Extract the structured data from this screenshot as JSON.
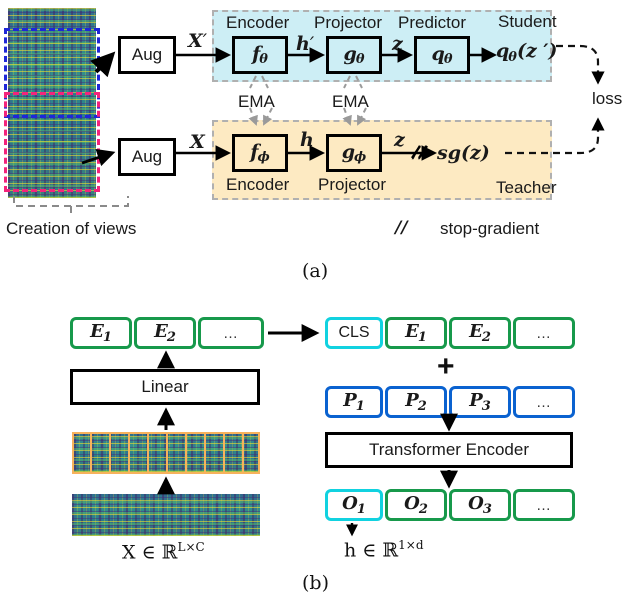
{
  "figure": {
    "panel_a_caption": "(a)",
    "panel_b_caption": "(b)"
  },
  "panel_a": {
    "creation_label": "Creation of views",
    "aug_top": "Aug",
    "aug_bottom": "Aug",
    "student_region_label": "Student",
    "teacher_region_label": "Teacher",
    "loss_label": "loss",
    "ema_label_1": "EMA",
    "ema_label_2": "EMA",
    "stopgrad_symbol": "//",
    "stopgrad_label": "stop-gradient",
    "student": {
      "encoder_label": "Encoder",
      "projector_label": "Projector",
      "predictor_label": "Predictor",
      "encoder_fn": "f",
      "encoder_sub": "θ",
      "projector_fn": "g",
      "projector_sub": "θ",
      "predictor_fn": "q",
      "predictor_sub": "θ",
      "input_signal": "X",
      "input_prime": "′",
      "h_signal": "h",
      "h_prime": "′",
      "z_signal": "z",
      "output_expr_fn": "q",
      "output_expr_sub": "θ",
      "output_expr_arg": "(z ′)"
    },
    "teacher": {
      "encoder_label": "Encoder",
      "projector_label": "Projector",
      "encoder_fn": "f",
      "encoder_sub": "ϕ",
      "projector_fn": "g",
      "projector_sub": "ϕ",
      "input_signal": "X",
      "h_signal": "h",
      "z_signal": "z",
      "sg_expr": "sg(z)"
    }
  },
  "panel_b": {
    "linear_label": "Linear",
    "transformer_label": "Transformer Encoder",
    "input_caption": "X ∈ ℝ",
    "input_caption_sup": "L×C",
    "output_caption": "h ∈ ℝ",
    "output_caption_sup": "1×d",
    "plus_symbol": "+",
    "embed_row": [
      {
        "base": "E",
        "sub": "1"
      },
      {
        "base": "E",
        "sub": "2"
      },
      {
        "base": "…",
        "sub": ""
      }
    ],
    "cls_row": [
      {
        "base": "CLS",
        "sub": "",
        "kind": "cls"
      },
      {
        "base": "E",
        "sub": "1",
        "kind": "emb"
      },
      {
        "base": "E",
        "sub": "2",
        "kind": "emb"
      },
      {
        "base": "…",
        "sub": "",
        "kind": "emb"
      }
    ],
    "pos_row": [
      {
        "base": "P",
        "sub": "1"
      },
      {
        "base": "P",
        "sub": "2"
      },
      {
        "base": "P",
        "sub": "3"
      },
      {
        "base": "…",
        "sub": ""
      }
    ],
    "out_row": [
      {
        "base": "O",
        "sub": "1",
        "kind": "cls"
      },
      {
        "base": "O",
        "sub": "2",
        "kind": "emb"
      },
      {
        "base": "O",
        "sub": "3",
        "kind": "emb"
      },
      {
        "base": "…",
        "sub": "",
        "kind": "emb"
      }
    ]
  },
  "colors": {
    "student_fill": "#cdeef5",
    "teacher_fill": "#fdeac2",
    "embed_green": "#17994b",
    "cls_cyan": "#11d2e0",
    "pos_blue": "#0a62d0",
    "patch_orange": "#f7b25c",
    "crop_blue": "#1f27d8",
    "crop_pink": "#f4247c"
  }
}
